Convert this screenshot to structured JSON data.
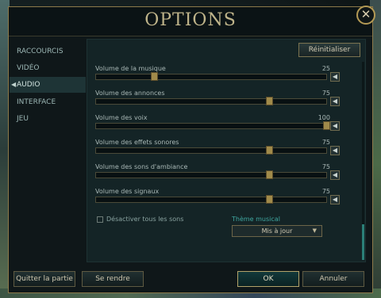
{
  "window": {
    "title": "OPTIONS",
    "close_label": "✕"
  },
  "sidebar": {
    "items": [
      {
        "label": "RACCOURCIS",
        "active": false
      },
      {
        "label": "VIDÉO",
        "active": false
      },
      {
        "label": "AUDIO",
        "active": true
      },
      {
        "label": "INTERFACE",
        "active": false
      },
      {
        "label": "JEU",
        "active": false
      }
    ],
    "active_arrow": "◀"
  },
  "panel": {
    "reset_label": "Réinitialiser",
    "sliders": [
      {
        "label": "Volume de la musique",
        "value": 25
      },
      {
        "label": "Volume des annonces",
        "value": 75
      },
      {
        "label": "Volume des voix",
        "value": 100
      },
      {
        "label": "Volume des effets sonores",
        "value": 75
      },
      {
        "label": "Volume des sons d'ambiance",
        "value": 75
      },
      {
        "label": "Volume des signaux",
        "value": 75
      }
    ],
    "mute_icon": "speaker-icon",
    "mute_glyph": "◀",
    "mute_all_label": "Désactiver tous les sons",
    "theme_label": "Thème musical",
    "theme_value": "Mis à jour",
    "theme_chevron": "▼"
  },
  "footer": {
    "quit_label": "Quitter la partie",
    "surrender_label": "Se rendre",
    "ok_label": "OK",
    "cancel_label": "Annuler"
  },
  "colors": {
    "accent": "#b2a36a",
    "teal": "#3fa7a0",
    "background": "#0f1719"
  }
}
